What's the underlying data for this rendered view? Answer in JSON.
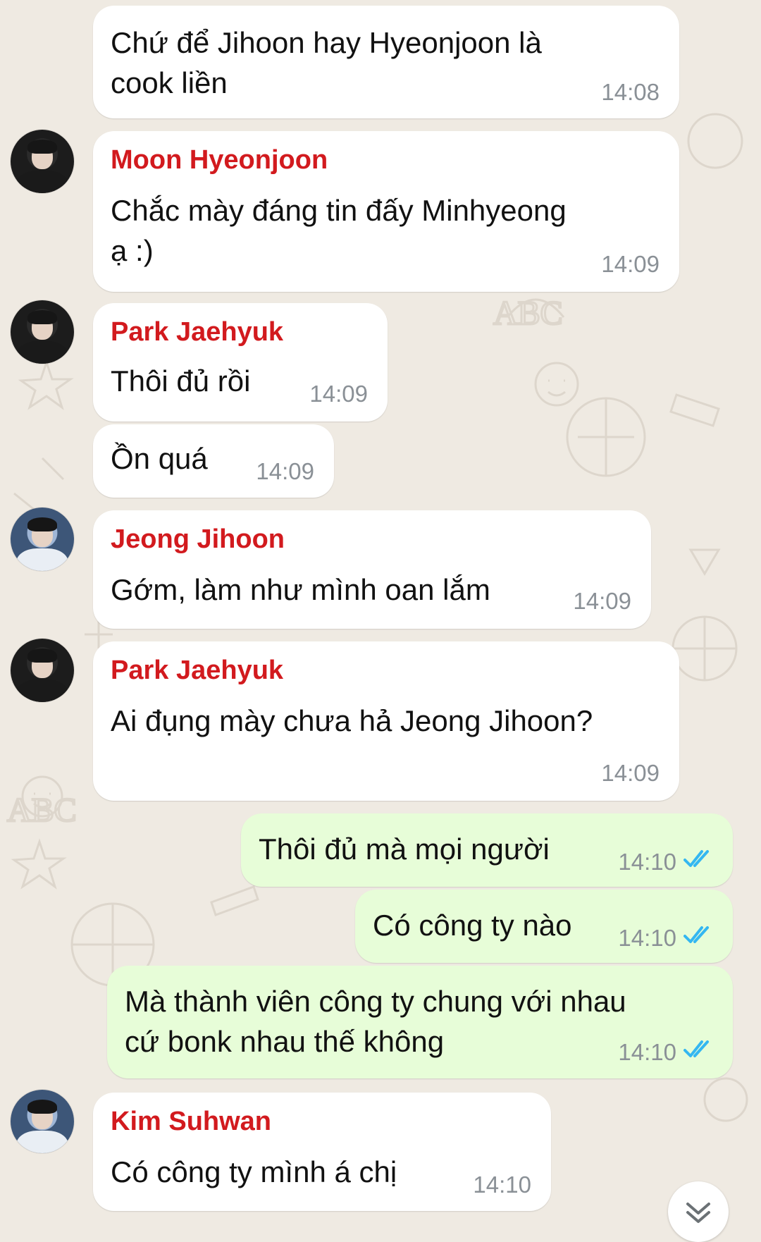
{
  "messages": [
    {
      "text": "Chứ để Jihoon hay Hyeonjoon là\ncook liền",
      "time": "14:08"
    },
    {
      "sender": "Moon Hyeonjoon",
      "text": "Chắc mày đáng tin đấy Minhyeong\nạ :)",
      "time": "14:09"
    },
    {
      "sender": "Park Jaehyuk",
      "text": "Thôi đủ rồi",
      "time": "14:09"
    },
    {
      "text": "Ồn quá",
      "time": "14:09"
    },
    {
      "sender": "Jeong Jihoon",
      "text": "Gớm, làm như mình oan lắm",
      "time": "14:09"
    },
    {
      "sender": "Park Jaehyuk",
      "text": "Ai đụng mày chưa hả Jeong Jihoon?",
      "time": "14:09"
    },
    {
      "text": "Thôi đủ mà mọi người",
      "time": "14:10",
      "status": "read"
    },
    {
      "text": "Có công ty nào",
      "time": "14:10",
      "status": "read"
    },
    {
      "text": "Mà thành viên công ty chung với nhau\ncứ bonk nhau thế không",
      "time": "14:10",
      "status": "read"
    },
    {
      "sender": "Kim Suhwan",
      "text": "Có công ty mình á chị",
      "time": "14:10"
    }
  ],
  "icons": {
    "read_receipt": "double-check-icon",
    "scroll_down": "chevron-down-icon"
  },
  "colors": {
    "background": "#efeae2",
    "incoming_bubble": "#ffffff",
    "outgoing_bubble": "#e7fdd8",
    "sender_name": "#d21a1e",
    "read_ticks": "#34b7f1",
    "timestamp": "#8a9096"
  }
}
